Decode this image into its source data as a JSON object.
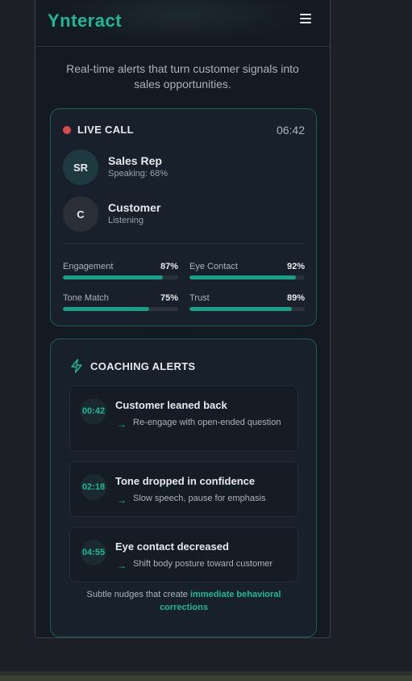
{
  "app": {
    "logo": "Ynteract",
    "tagline": "Real-time alerts that turn customer signals into sales opportunities."
  },
  "colors": {
    "accent": "#1fb79a",
    "live": "#d64c4c",
    "background": "#1c2026",
    "card": "#18212b"
  },
  "live_call": {
    "label": "LIVE CALL",
    "timer": "06:42",
    "participants": [
      {
        "initials": "SR",
        "name": "Sales Rep",
        "status": "Speaking: 68%"
      },
      {
        "initials": "C",
        "name": "Customer",
        "status": "Listening"
      }
    ],
    "metrics": [
      {
        "label": "Engagement",
        "value": "87%",
        "level": 0.87
      },
      {
        "label": "Eye Contact",
        "value": "92%",
        "level": 0.92
      },
      {
        "label": "Tone Match",
        "value": "75%",
        "level": 0.75
      },
      {
        "label": "Trust",
        "value": "89%",
        "level": 0.89
      }
    ]
  },
  "coaching": {
    "title": "COACHING ALERTS",
    "icon": "bolt-icon",
    "alerts": [
      {
        "time": "00:42",
        "title": "Customer leaned back",
        "action": "Re-engage with open-ended question"
      },
      {
        "time": "02:18",
        "title": "Tone dropped in confidence",
        "action": "Slow speech, pause for emphasis"
      },
      {
        "time": "04:55",
        "title": "Eye contact decreased",
        "action": "Shift body posture toward customer"
      }
    ],
    "footnote_prefix": "Subtle nudges that create ",
    "footnote_highlight": "immediate behavioral corrections"
  }
}
